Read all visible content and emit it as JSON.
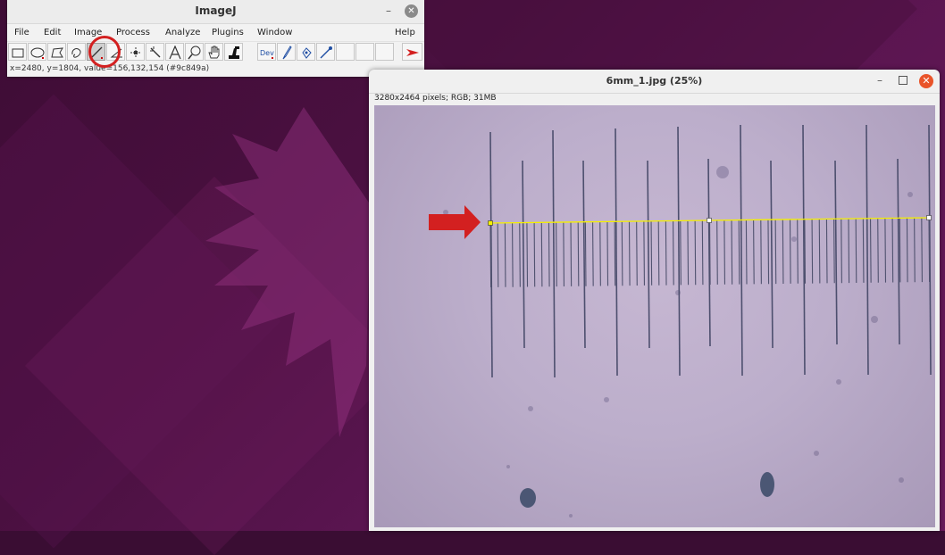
{
  "imagej": {
    "title": "ImageJ",
    "menu": [
      "File",
      "Edit",
      "Image",
      "Process",
      "Analyze",
      "Plugins",
      "Window",
      "Help"
    ],
    "status": "x=2480, y=1804, value=156,132,154 (#9c849a)",
    "tools": [
      "rectangle-tool-icon",
      "oval-tool-icon",
      "polygon-tool-icon",
      "freehand-tool-icon",
      "straight-line-tool-icon",
      "angle-tool-icon",
      "point-tool-icon",
      "wand-tool-icon",
      "text-tool-icon",
      "magnifier-tool-icon",
      "hand-tool-icon",
      "color-picker-tool-icon",
      "developer-menu-icon",
      "brush-tool-icon",
      "flood-fill-tool-icon",
      "pipette-tool-icon",
      "more-tools-arrow-icon"
    ],
    "selected_tool": "straight-line-tool-icon",
    "dev_label": "Dev",
    "highlight_color": "#d32020"
  },
  "image_window": {
    "title": "6mm_1.jpg (25%)",
    "info": "3280x2464 pixels; RGB; 31MB",
    "line_color": "#f5f000",
    "arrow_color": "#d32020"
  }
}
